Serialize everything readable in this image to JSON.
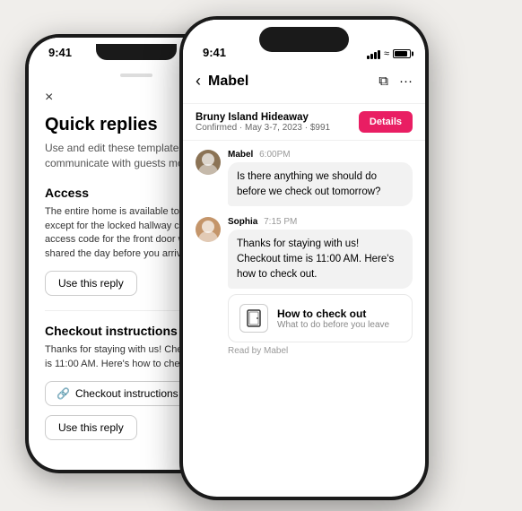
{
  "scene": {
    "bg_color": "#f0eeeb"
  },
  "phone_back": {
    "status_time": "9:41",
    "handle_hint": "drag handle",
    "close_label": "×",
    "title": "Quick replies",
    "subtitle": "Use and edit these templates to communicate with guests more easily.",
    "section1_title": "Access",
    "section1_body": "The entire home is available to you, except for the locked hallway closet. The access code for the front door will be shared the day before you arrive.",
    "use_reply_btn1": "Use this reply",
    "section2_title": "Checkout instructions",
    "section2_body": "Thanks for staying with us! Checkout time is 11:00 AM.  Here's how to check out.",
    "link_btn": "Checkout instructions",
    "use_reply_btn2": "Use this reply"
  },
  "phone_front": {
    "status_time": "9:41",
    "contact_name": "Mabel",
    "back_label": "‹",
    "booking_title": "Bruny Island Hideaway",
    "booking_sub": "Confirmed · May 3-7, 2023 · $991",
    "details_btn": "Details",
    "messages": [
      {
        "sender": "Mabel",
        "time": "6:00PM",
        "text": "Is there anything we should do before we check out tomorrow?"
      },
      {
        "sender": "Sophia",
        "time": "7:15 PM",
        "text": "Thanks for staying with us! Checkout time is 11:00 AM. Here's how to check out."
      }
    ],
    "checkout_card_title": "How to check out",
    "checkout_card_sub": "What to do before you leave",
    "read_receipt": "Read by Mabel"
  }
}
